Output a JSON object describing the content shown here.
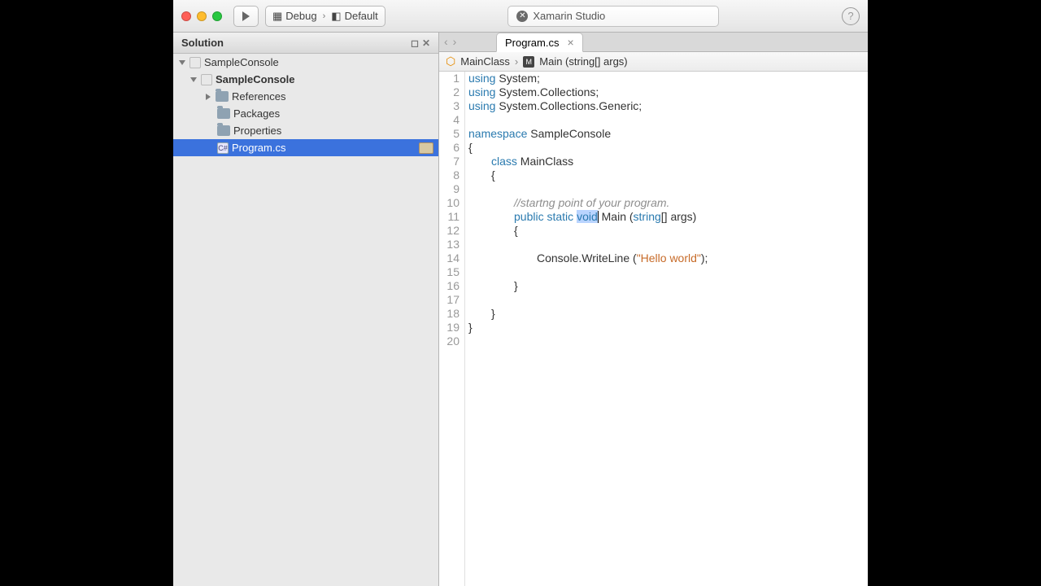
{
  "toolbar": {
    "debug_label": "Debug",
    "config_label": "Default",
    "title": "Xamarin Studio"
  },
  "sidebar": {
    "header": "Solution",
    "solution_name": "SampleConsole",
    "project_name": "SampleConsole",
    "nodes": {
      "references": "References",
      "packages": "Packages",
      "properties": "Properties",
      "program": "Program.cs"
    }
  },
  "tabs": {
    "active": "Program.cs"
  },
  "breadcrumb": {
    "class": "MainClass",
    "method": "Main (string[] args)"
  },
  "code": {
    "line_count": 20,
    "tokens": {
      "using": "using",
      "namespace": "namespace",
      "class": "class",
      "public": "public",
      "static": "static",
      "void": "void",
      "string_kw": "string",
      "system": "System;",
      "collections": "System.Collections;",
      "generic": "System.Collections.Generic;",
      "ns_name": "SampleConsole",
      "class_name": "MainClass",
      "comment": "//startng point of your program.",
      "main_sig_tail": " Main (",
      "args_tail": "[] args)",
      "console_write": "Console.WriteLine (",
      "hello": "\"Hello world\"",
      "close_paren": ");"
    }
  }
}
